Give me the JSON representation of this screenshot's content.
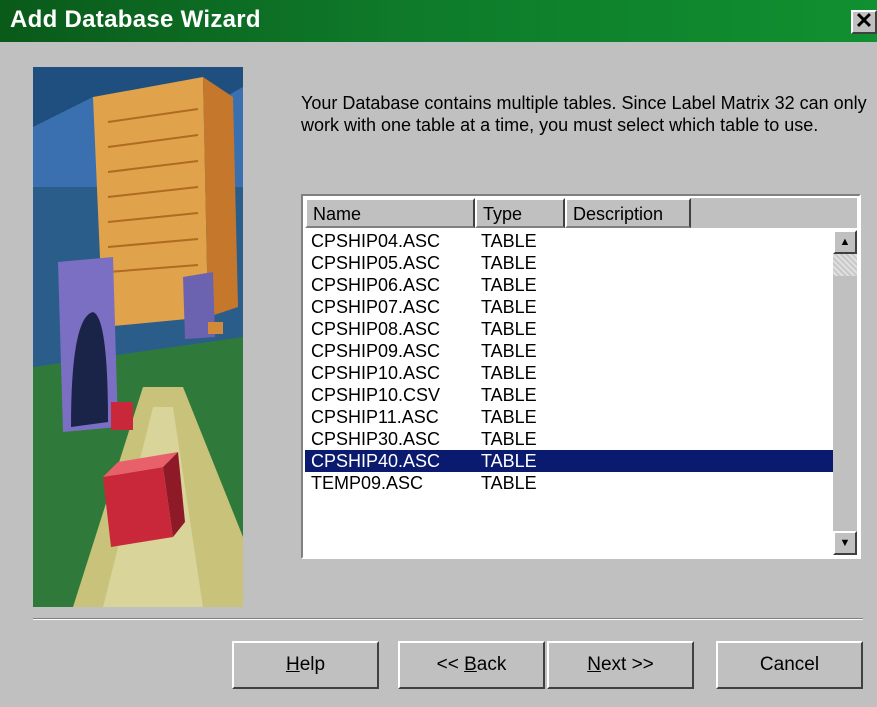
{
  "window": {
    "title": "Add Database Wizard",
    "close_glyph": "✕"
  },
  "intro_text": "Your Database contains multiple tables.  Since Label Matrix 32 can only work with one table at a time, you must select which table to use.",
  "table": {
    "columns": [
      "Name",
      "Type",
      "Description"
    ],
    "rows": [
      {
        "name": "CPSHIP04.ASC",
        "type": "TABLE",
        "selected": false
      },
      {
        "name": "CPSHIP05.ASC",
        "type": "TABLE",
        "selected": false
      },
      {
        "name": "CPSHIP06.ASC",
        "type": "TABLE",
        "selected": false
      },
      {
        "name": "CPSHIP07.ASC",
        "type": "TABLE",
        "selected": false
      },
      {
        "name": "CPSHIP08.ASC",
        "type": "TABLE",
        "selected": false
      },
      {
        "name": "CPSHIP09.ASC",
        "type": "TABLE",
        "selected": false
      },
      {
        "name": "CPSHIP10.ASC",
        "type": "TABLE",
        "selected": false
      },
      {
        "name": "CPSHIP10.CSV",
        "type": "TABLE",
        "selected": false
      },
      {
        "name": "CPSHIP11.ASC",
        "type": "TABLE",
        "selected": false
      },
      {
        "name": "CPSHIP30.ASC",
        "type": "TABLE",
        "selected": false
      },
      {
        "name": "CPSHIP40.ASC",
        "type": "TABLE",
        "selected": true
      },
      {
        "name": "TEMP09.ASC",
        "type": "TABLE",
        "selected": false
      }
    ],
    "scroll": {
      "up_glyph": "▲",
      "down_glyph": "▼"
    }
  },
  "buttons": {
    "help": {
      "label": "Help",
      "mnemonic_index": 0
    },
    "back": {
      "label": "<< Back",
      "mnemonic_index": 3
    },
    "next": {
      "label": "Next >>",
      "mnemonic_index": 0
    },
    "cancel": {
      "label": "Cancel",
      "mnemonic_index": -1
    }
  },
  "colors": {
    "titlebar": "#0e7a2a",
    "selection": "#0a1a6e",
    "face": "#c0c0c0"
  },
  "icons": {
    "close": "close-icon",
    "scroll_up": "scroll-up-icon",
    "scroll_down": "scroll-down-icon"
  }
}
